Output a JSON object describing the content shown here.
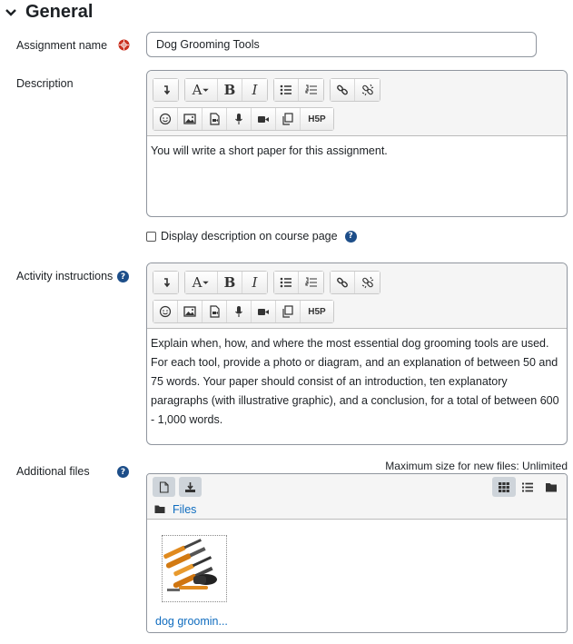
{
  "section": {
    "title": "General"
  },
  "assignment_name": {
    "label": "Assignment name",
    "value": "Dog Grooming Tools"
  },
  "description": {
    "label": "Description",
    "content": "You will write a short paper for this assignment."
  },
  "display_description": {
    "label": "Display description on course page",
    "checked": false
  },
  "activity_instructions": {
    "label": "Activity instructions",
    "content": "Explain when, how, and where the most essential dog grooming tools are used. For each tool, provide a photo or diagram, and an explanation of between 50 and 75 words. Your paper should consist of an introduction, ten explanatory paragraphs (with illustrative graphic), and a conclusion, for a total of between 600 - 1,000 words."
  },
  "additional_files": {
    "label": "Additional files",
    "max_size": "Maximum size for new files: Unlimited",
    "path_label": "Files",
    "files": [
      {
        "name": "dog groomin..."
      }
    ]
  },
  "toolbar": {
    "bold": "B",
    "italic": "I",
    "font": "A",
    "h5p": "H5P"
  },
  "colors": {
    "accent": "#0f6cbf",
    "help": "#1d4e89",
    "required": "#ca3120"
  }
}
